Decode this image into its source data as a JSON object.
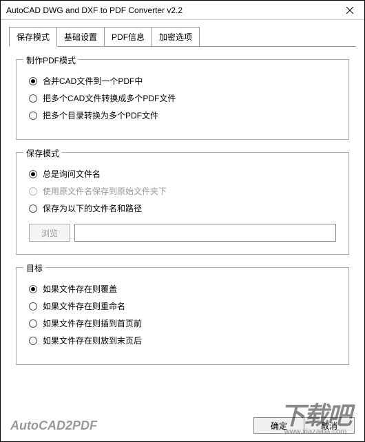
{
  "window": {
    "title": "AutoCAD DWG and DXF to PDF Converter v2.2"
  },
  "tabs": {
    "save_mode": "保存模式",
    "basic_settings": "基础设置",
    "pdf_info": "PDF信息",
    "encrypt_options": "加密选项"
  },
  "group_pdf_mode": {
    "legend": "制作PDF模式",
    "opt_merge": "合并CAD文件到一个PDF中",
    "opt_multi_files": "把多个CAD文件转换成多个PDF文件",
    "opt_multi_dirs": "把多个目录转换为多个PDF文件"
  },
  "group_save_mode": {
    "legend": "保存模式",
    "opt_always_ask": "总是询问文件名",
    "opt_use_original": "使用原文件名保存到原始文件夹下",
    "opt_save_as": "保存为以下的文件名和路径",
    "browse_label": "浏览",
    "path_value": ""
  },
  "group_target": {
    "legend": "目标",
    "opt_overwrite": "如果文件存在则覆盖",
    "opt_rename": "如果文件存在则重命名",
    "opt_insert_first": "如果文件存在则插到首页前",
    "opt_append_last": "如果文件存在则放到末页后"
  },
  "footer": {
    "brand": "AutoCAD2PDF",
    "ok": "确定",
    "cancel": "取消"
  },
  "watermark": {
    "text": "下载吧",
    "url": "www.xiazaiba.com"
  }
}
